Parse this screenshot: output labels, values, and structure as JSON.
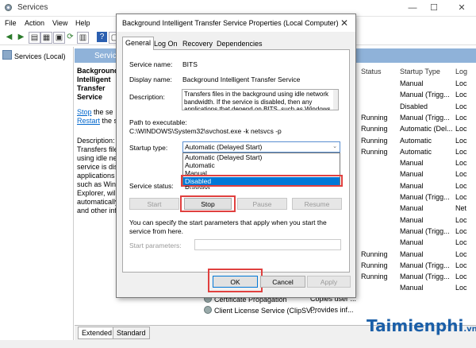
{
  "window": {
    "title": "Services",
    "menu": [
      "File",
      "Action",
      "View",
      "Help"
    ]
  },
  "tree": {
    "item": "Services (Local)"
  },
  "pane": {
    "header": "Service",
    "service_name": "Background Intelligent Transfer Service",
    "stop_link": "Stop",
    "stop_suffix": " the se",
    "restart_link": "Restart",
    "restart_suffix": " the s",
    "desc_label": "Description:",
    "desc_lines": [
      "Transfers file",
      "using idle ne",
      "service is dis",
      "applications",
      "such as Wind",
      "Explorer, will",
      "automatically",
      "and other inf"
    ]
  },
  "columns": {
    "status": "Status",
    "startup": "Startup Type",
    "log": "Log"
  },
  "rows": [
    {
      "status": "",
      "startup": "Manual",
      "log": "Loc"
    },
    {
      "status": "",
      "startup": "Manual (Trigg...",
      "log": "Loc"
    },
    {
      "status": "",
      "startup": "Disabled",
      "log": "Loc"
    },
    {
      "status": "Running",
      "startup": "Manual (Trigg...",
      "log": "Loc"
    },
    {
      "status": "Running",
      "startup": "Automatic (Del...",
      "log": "Loc"
    },
    {
      "status": "Running",
      "startup": "Automatic",
      "log": "Loc"
    },
    {
      "status": "Running",
      "startup": "Automatic",
      "log": "Loc"
    },
    {
      "status": "",
      "startup": "Manual",
      "log": "Loc"
    },
    {
      "status": "",
      "startup": "Manual",
      "log": "Loc"
    },
    {
      "status": "",
      "startup": "Manual",
      "log": "Loc"
    },
    {
      "status": "",
      "startup": "Manual (Trigg...",
      "log": "Loc"
    },
    {
      "status": "",
      "startup": "Manual",
      "log": "Net"
    },
    {
      "status": "",
      "startup": "Manual",
      "log": "Loc"
    },
    {
      "status": "",
      "startup": "Manual (Trigg...",
      "log": "Loc"
    },
    {
      "status": "",
      "startup": "Manual",
      "log": "Loc"
    },
    {
      "status": "Running",
      "startup": "Manual",
      "log": "Loc"
    },
    {
      "status": "Running",
      "startup": "Manual (Trigg...",
      "log": "Loc"
    },
    {
      "status": "Running",
      "startup": "Manual (Trigg...",
      "log": "Loc"
    },
    {
      "status": "",
      "startup": "Manual",
      "log": "Loc"
    }
  ],
  "list_items": [
    {
      "name": "Certificate Propagation",
      "desc": "Copies user ..."
    },
    {
      "name": "Client License Service (ClipSV...",
      "desc": "Provides inf..."
    }
  ],
  "bottom_tabs": [
    "Extended",
    "Standard"
  ],
  "dialog": {
    "title": "Background Intelligent Transfer Service Properties (Local Computer)",
    "close": "✕",
    "tabs": [
      "General",
      "Log On",
      "Recovery",
      "Dependencies"
    ],
    "service_name_label": "Service name:",
    "service_name": "BITS",
    "display_name_label": "Display name:",
    "display_name": "Background Intelligent Transfer Service",
    "description_label": "Description:",
    "description": "Transfers files in the background using idle network bandwidth. If the service is disabled, then any applications that depend on BITS, such as Windows",
    "path_label": "Path to executable:",
    "path": "C:\\WINDOWS\\System32\\svchost.exe -k netsvcs -p",
    "startup_label": "Startup type:",
    "startup_value": "Automatic (Delayed Start)",
    "startup_options": [
      "Automatic (Delayed Start)",
      "Automatic",
      "Manual",
      "Disabled"
    ],
    "status_label": "Service status:",
    "status_value": "Running",
    "buttons": {
      "start": "Start",
      "stop": "Stop",
      "pause": "Pause",
      "resume": "Resume"
    },
    "hint": "You can specify the start parameters that apply when you start the service from here.",
    "params_label": "Start parameters:",
    "ok": "OK",
    "cancel": "Cancel",
    "apply": "Apply"
  },
  "watermark": {
    "brand": "Taimienphi",
    "tld": ".vn"
  }
}
